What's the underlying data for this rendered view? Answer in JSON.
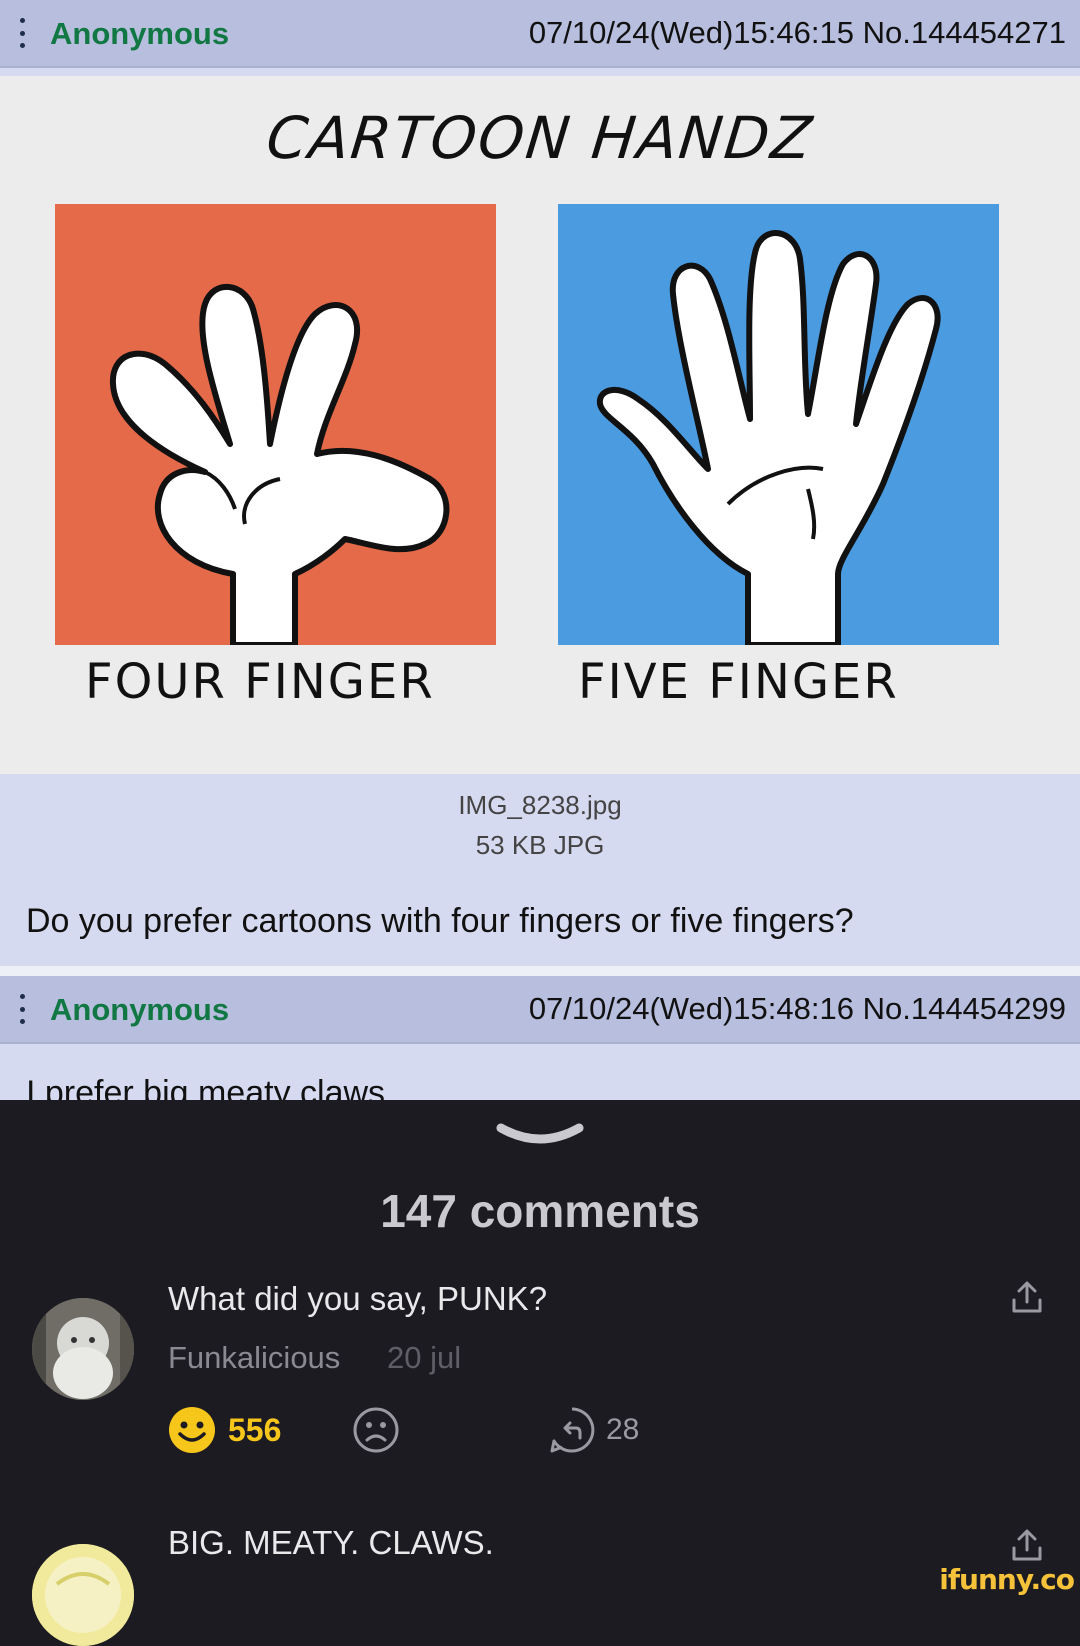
{
  "post1": {
    "poster": "Anonymous",
    "meta": "07/10/24(Wed)15:46:15 No.144454271",
    "image": {
      "title": "CARTOON HANDZ",
      "left_caption": "FOUR FINGER",
      "right_caption": "FIVE FINGER",
      "left_color": "#e46a49",
      "right_color": "#4b9be0"
    },
    "file_name": "IMG_8238.jpg",
    "file_size": "53 KB JPG",
    "text": "Do you prefer cartoons with four fingers or five fingers?"
  },
  "post2": {
    "poster": "Anonymous",
    "meta": "07/10/24(Wed)15:48:16 No.144454299",
    "text": "I prefer big meaty claws"
  },
  "comments": {
    "count_label": "147 comments",
    "items": [
      {
        "text": "What did you say, PUNK?",
        "user": "Funkalicious",
        "date": "20 jul",
        "smiles": "556",
        "replies": "28"
      },
      {
        "text": "BIG. MEATY. CLAWS."
      }
    ]
  },
  "watermark": "ifunny.co",
  "colors": {
    "poster_name": "#117743",
    "header_bg": "#b7bede",
    "post_bg": "#d6daf0",
    "dark_bg": "#1c1b21",
    "smile": "#f7c61b"
  }
}
